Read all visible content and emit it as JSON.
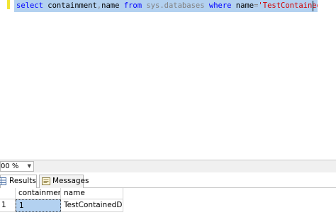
{
  "editor": {
    "query_tokens": [
      {
        "cls": "kw",
        "text": "select"
      },
      {
        "cls": "txt",
        "text": " containment"
      },
      {
        "cls": "sym",
        "text": ","
      },
      {
        "cls": "txt",
        "text": "name "
      },
      {
        "cls": "kw",
        "text": "from"
      },
      {
        "cls": "txt",
        "text": " "
      },
      {
        "cls": "sym",
        "text": "sys.databases"
      },
      {
        "cls": "txt",
        "text": " "
      },
      {
        "cls": "kw",
        "text": "where"
      },
      {
        "cls": "txt",
        "text": " name"
      },
      {
        "cls": "sym",
        "text": "="
      },
      {
        "cls": "str",
        "text": "'TestContainedDB'"
      }
    ]
  },
  "zoom": {
    "value": "00 %"
  },
  "tabs": {
    "results_label": "Results",
    "messages_label": "Messages"
  },
  "grid": {
    "columns": [
      "containment",
      "name"
    ],
    "rows": [
      {
        "row_number": "1",
        "containment": "1",
        "name": "TestContainedDB"
      }
    ]
  },
  "colors": {
    "selection": "#b3d1f0",
    "keyword": "#0000ff",
    "string": "#d00000",
    "gutter_change": "#f2e533"
  }
}
